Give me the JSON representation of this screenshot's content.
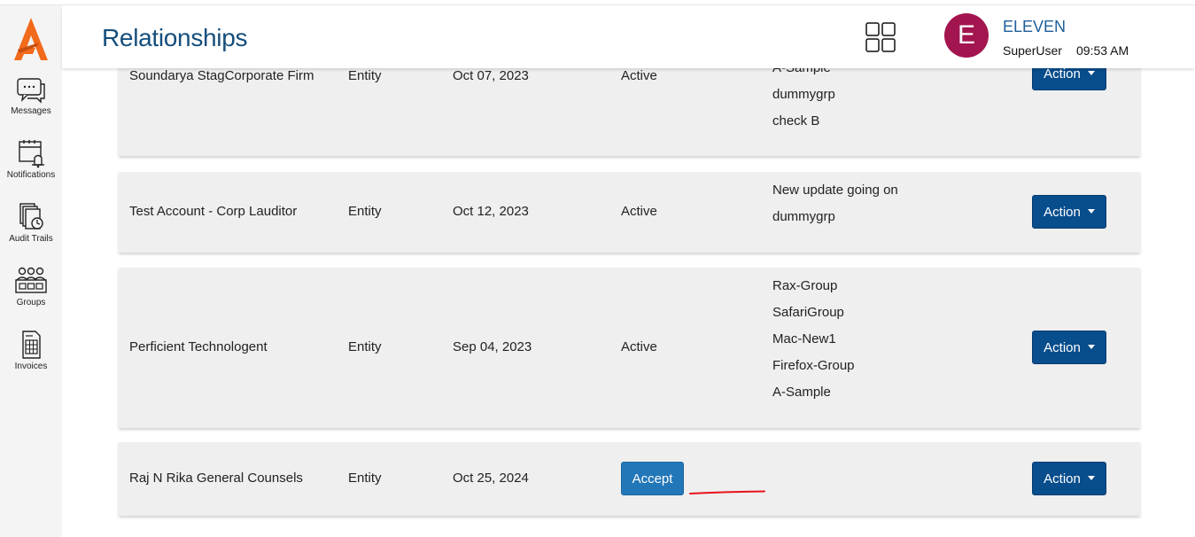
{
  "header": {
    "title": "Relationships",
    "user_initial": "E",
    "user_name": "ELEVEN",
    "user_role": "SuperUser",
    "time": "09:53 AM",
    "avatar_color": "#a3154f"
  },
  "sidebar": {
    "items": [
      {
        "label": "Messages",
        "icon": "messages-icon"
      },
      {
        "label": "Notifications",
        "icon": "notifications-icon"
      },
      {
        "label": "Audit Trails",
        "icon": "audit-trails-icon"
      },
      {
        "label": "Groups",
        "icon": "groups-icon"
      },
      {
        "label": "Invoices",
        "icon": "invoices-icon"
      }
    ]
  },
  "rows": [
    {
      "name": "Soundarya StagCorporate Firm",
      "type": "Entity",
      "date": "Oct 07, 2023",
      "status": "Active",
      "groups": [
        "A-Sample",
        "dummygrp",
        "check B"
      ],
      "action_label": "Action"
    },
    {
      "name": "Test Account - Corp Lauditor",
      "type": "Entity",
      "date": "Oct 12, 2023",
      "status": "Active",
      "groups": [
        "New update going on",
        "dummygrp"
      ],
      "action_label": "Action"
    },
    {
      "name": "Perficient Technologent",
      "type": "Entity",
      "date": "Sep 04, 2023",
      "status": "Active",
      "groups": [
        "Rax-Group",
        "SafariGroup",
        "Mac-New1",
        "Firefox-Group",
        "A-Sample"
      ],
      "action_label": "Action"
    },
    {
      "name": "Raj N Rika General Counsels",
      "type": "Entity",
      "date": "Oct 25, 2024",
      "accept_label": "Accept",
      "action_label": "Action"
    }
  ],
  "colors": {
    "brand_orange": "#f26a1b",
    "title_blue": "#154e7c",
    "action_button": "#084d8c",
    "accept_button": "#2277b8",
    "annotation_red": "#e8141b"
  }
}
